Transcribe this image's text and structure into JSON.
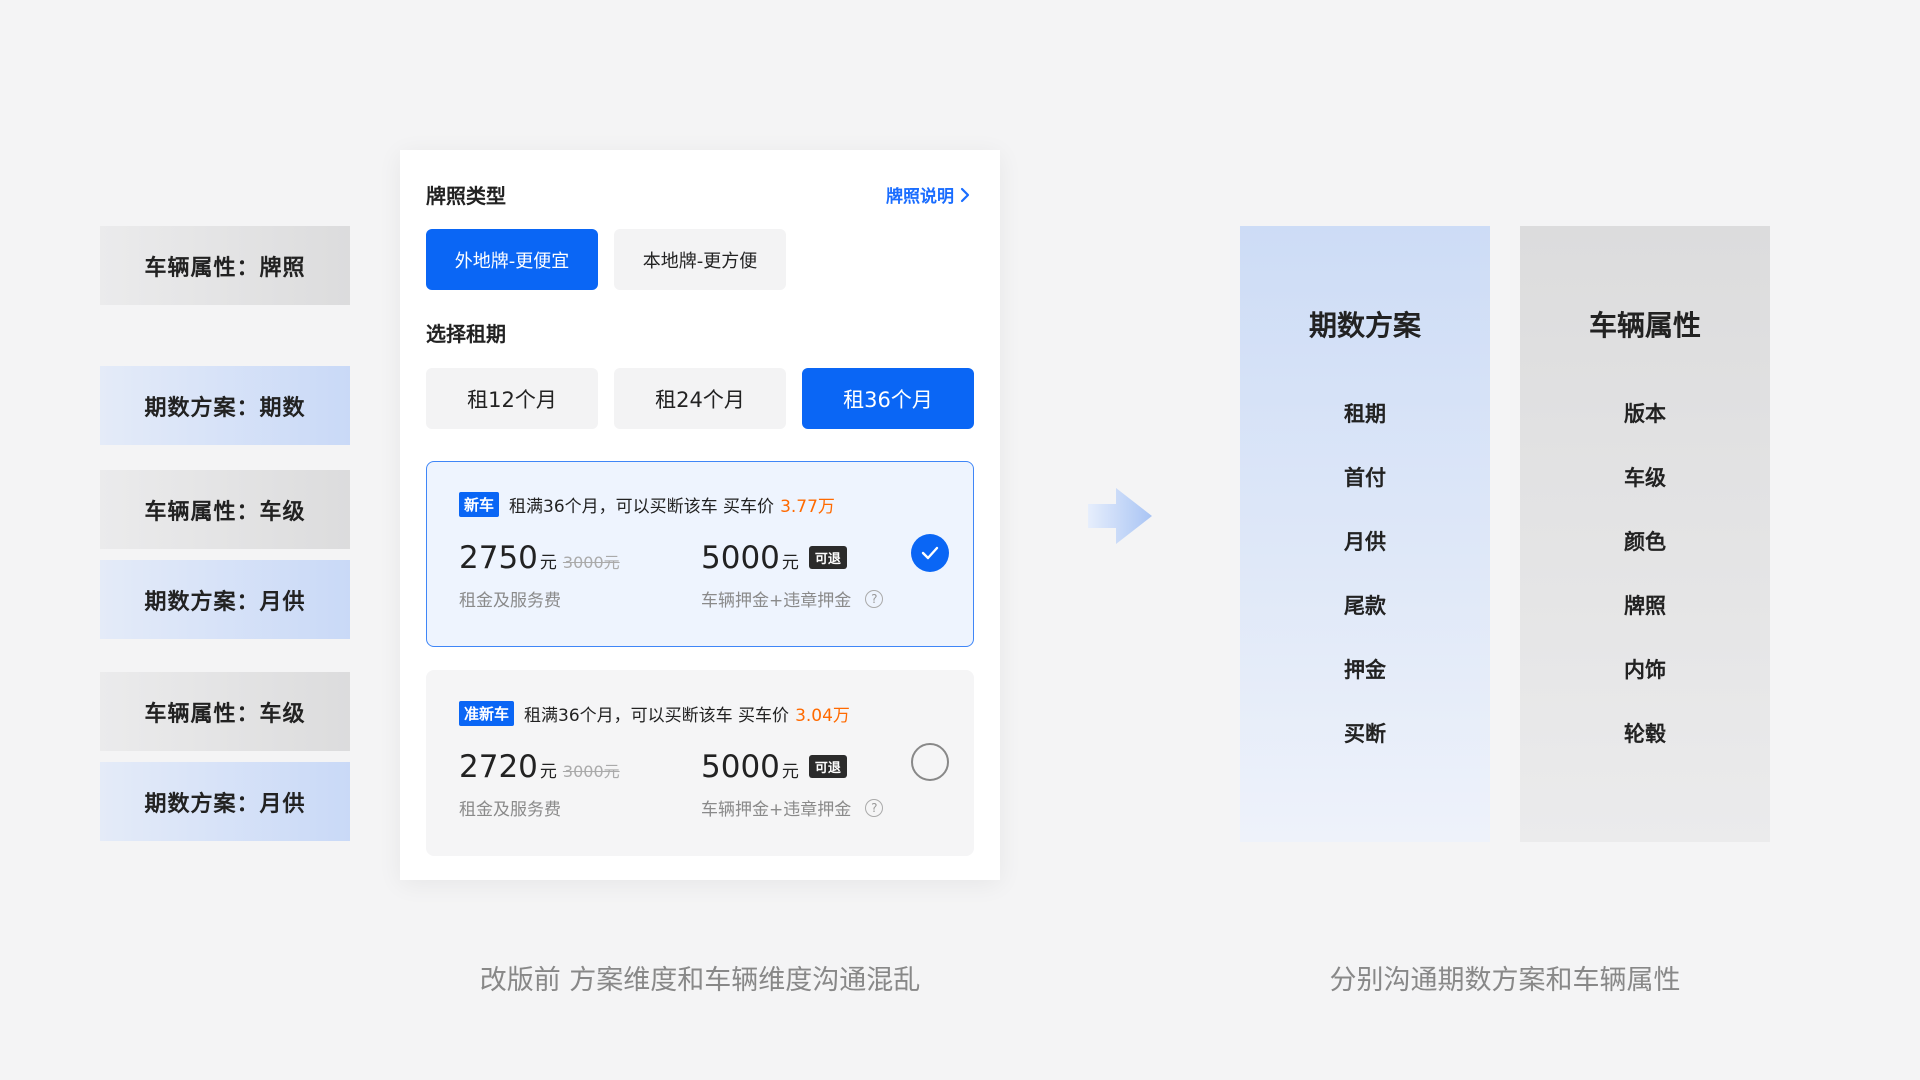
{
  "left_tags": [
    {
      "label": "车辆属性：牌照"
    },
    {
      "label": "期数方案：期数"
    },
    {
      "label": "车辆属性：车级"
    },
    {
      "label": "期数方案：月供"
    },
    {
      "label": "车辆属性：车级"
    },
    {
      "label": "期数方案：月供"
    }
  ],
  "card": {
    "plate_title": "牌照类型",
    "plate_link": "牌照说明",
    "plate_options": [
      {
        "label": "外地牌-更便宜",
        "selected": true
      },
      {
        "label": "本地牌-更方便",
        "selected": false
      }
    ],
    "term_title": "选择租期",
    "term_options": [
      {
        "label": "租12个月",
        "selected": false
      },
      {
        "label": "租24个月",
        "selected": false
      },
      {
        "label": "租36个月",
        "selected": true
      }
    ],
    "plans": [
      {
        "badge": "新车",
        "desc": "租满36个月，可以买断该车 买车价",
        "buyout_price": "3.77万",
        "rent_amount": "2750",
        "rent_unit": "元",
        "rent_original": "3000元",
        "rent_label": "租金及服务费",
        "deposit_amount": "5000",
        "deposit_unit": "元",
        "refund_tag": "可退",
        "deposit_label": "车辆押金+违章押金",
        "help": "?",
        "selected": true
      },
      {
        "badge": "准新车",
        "desc": "租满36个月，可以买断该车 买车价",
        "buyout_price": "3.04万",
        "rent_amount": "2720",
        "rent_unit": "元",
        "rent_original": "3000元",
        "rent_label": "租金及服务费",
        "deposit_amount": "5000",
        "deposit_unit": "元",
        "refund_tag": "可退",
        "deposit_label": "车辆押金+违章押金",
        "help": "?",
        "selected": false
      }
    ]
  },
  "columns": {
    "plan": {
      "title": "期数方案",
      "items": [
        "租期",
        "首付",
        "月供",
        "尾款",
        "押金",
        "买断"
      ]
    },
    "vehicle": {
      "title": "车辆属性",
      "items": [
        "版本",
        "车级",
        "颜色",
        "牌照",
        "内饰",
        "轮毂"
      ]
    }
  },
  "captions": {
    "left": "改版前 方案维度和车辆维度沟通混乱",
    "right": "分别沟通期数方案和车辆属性"
  },
  "colors": {
    "accent": "#0a66f5",
    "price_highlight": "#ff6a00",
    "link": "#1a6dff"
  }
}
